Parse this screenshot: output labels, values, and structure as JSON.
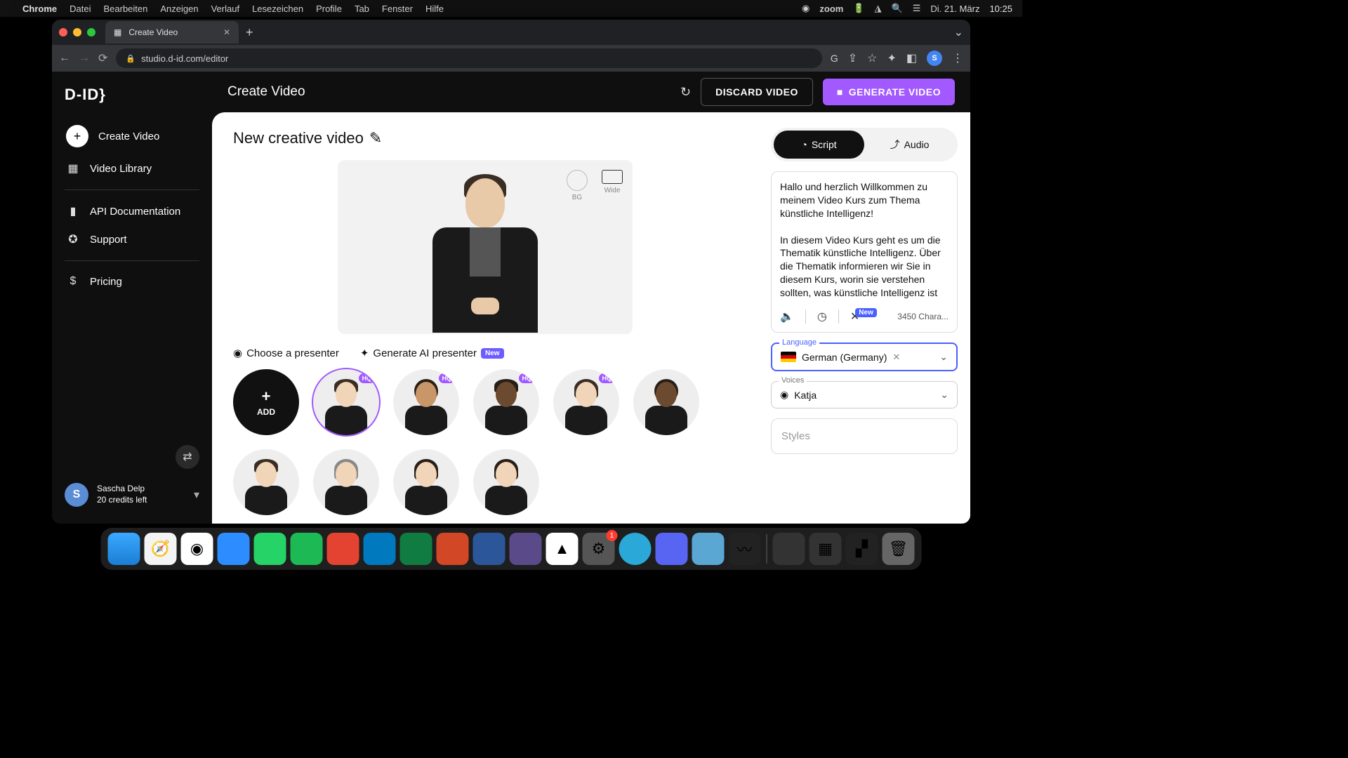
{
  "menubar": {
    "app": "Chrome",
    "items": [
      "Datei",
      "Bearbeiten",
      "Anzeigen",
      "Verlauf",
      "Lesezeichen",
      "Profile",
      "Tab",
      "Fenster",
      "Hilfe"
    ],
    "zoom": "zoom",
    "date": "Di. 21. März",
    "time": "10:25"
  },
  "browser": {
    "tab_title": "Create Video",
    "url": "studio.d-id.com/editor",
    "profile_initial": "S"
  },
  "app": {
    "logo": "D-ID}",
    "title": "Create Video",
    "discard": "DISCARD VIDEO",
    "generate": "GENERATE VIDEO"
  },
  "sidebar": {
    "items": [
      {
        "icon": "plus",
        "label": "Create Video"
      },
      {
        "icon": "grid",
        "label": "Video Library"
      },
      {
        "icon": "doc",
        "label": "API Documentation"
      },
      {
        "icon": "support",
        "label": "Support"
      },
      {
        "icon": "pricing",
        "label": "Pricing"
      }
    ],
    "user": {
      "initial": "S",
      "name": "Sascha Delp",
      "credits": "20 credits left"
    }
  },
  "canvas": {
    "video_title": "New creative video",
    "bg_label": "BG",
    "wide_label": "Wide",
    "tab_choose": "Choose a presenter",
    "tab_generate": "Generate AI presenter",
    "new_badge": "New",
    "add_label": "ADD",
    "hq": "HQ"
  },
  "panel": {
    "script_tab": "Script",
    "audio_tab": "Audio",
    "script_text": "Hallo und herzlich Willkommen zu meinem Video Kurs zum Thema künstliche Intelligenz!\n\nIn diesem Video Kurs geht es um die Thematik künstliche Intelligenz. Über die Thematik informieren wir Sie in diesem Kurs, worin sie verstehen sollten, was künstliche Intelligenz ist und welche",
    "new_badge": "New",
    "char_count": "3450 Chara...",
    "language_label": "Language",
    "language_value": "German (Germany)",
    "voices_label": "Voices",
    "voices_value": "Katja",
    "styles_label": "Styles"
  },
  "dock": {
    "settings_badge": "1"
  }
}
